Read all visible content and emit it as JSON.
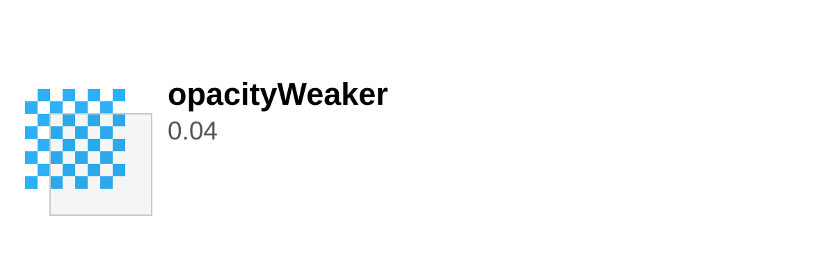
{
  "token": {
    "name": "opacityWeaker",
    "value": "0.04"
  },
  "colors": {
    "checker": "#2db0f6",
    "overlay_fill": "rgba(0,0,0,0.04)",
    "overlay_border": "#c8c8c8",
    "name_text": "#000000",
    "value_text": "#555555"
  }
}
